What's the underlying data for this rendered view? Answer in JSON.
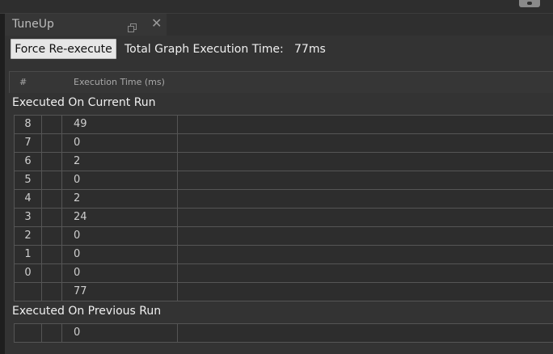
{
  "panel": {
    "tab_title": "TuneUp",
    "close_glyph": "✕"
  },
  "toolbar": {
    "force_label": "Force Re-execute",
    "total_label": "Total Graph Execution Time:",
    "total_value": "77ms"
  },
  "columns": {
    "number": "#",
    "execution_time": "Execution Time (ms)"
  },
  "current_run": {
    "label": "Executed On Current Run",
    "rows": [
      {
        "num": "8",
        "time": "49"
      },
      {
        "num": "7",
        "time": "0"
      },
      {
        "num": "6",
        "time": "2"
      },
      {
        "num": "5",
        "time": "0"
      },
      {
        "num": "4",
        "time": "2"
      },
      {
        "num": "3",
        "time": "24"
      },
      {
        "num": "2",
        "time": "0"
      },
      {
        "num": "1",
        "time": "0"
      },
      {
        "num": "0",
        "time": "0"
      },
      {
        "num": "",
        "time": "77"
      }
    ]
  },
  "previous_run": {
    "label": "Executed On Previous Run",
    "rows": [
      {
        "num": "",
        "time": "0"
      }
    ]
  },
  "icons": {
    "undock": "undock-icon",
    "close": "close-icon",
    "camera": "camera-icon"
  }
}
